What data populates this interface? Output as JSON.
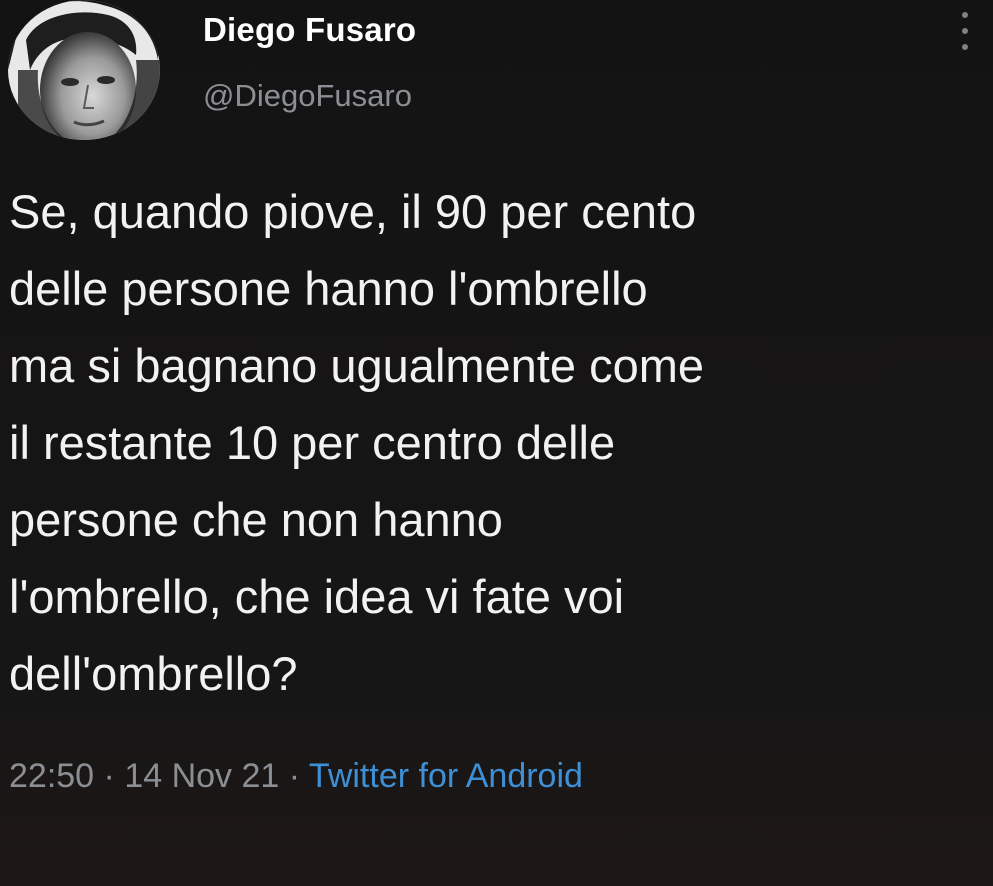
{
  "tweet": {
    "display_name": "Diego Fusaro",
    "handle": "@DiegoFusaro",
    "text": "Se, quando piove, il 90 per cento\ndelle persone hanno l'ombrello\nma si bagnano ugualmente come\nil restante 10 per centro delle\npersone che non hanno\nl'ombrello, che idea vi fate voi\ndell'ombrello?",
    "time": "22:50",
    "separator": " · ",
    "date": "14 Nov 21",
    "source": "Twitter for Android"
  },
  "icons": {
    "more": "more-vertical-icon"
  },
  "colors": {
    "background": "#161515",
    "text": "#f2f2f2",
    "secondary": "#8b8f94",
    "link": "#3d8fd6"
  }
}
